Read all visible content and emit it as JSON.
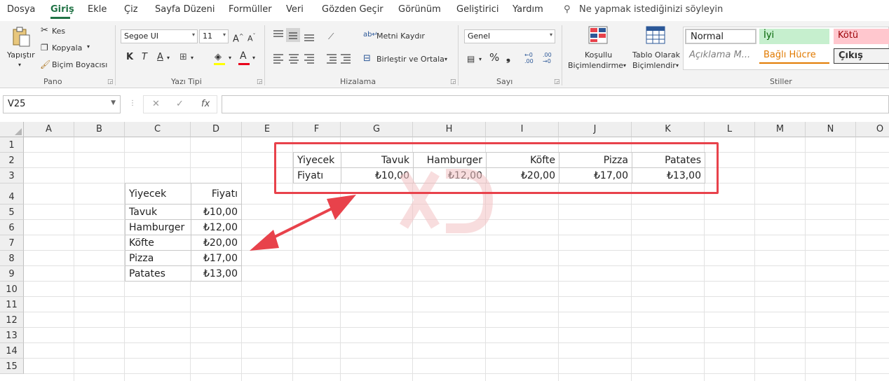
{
  "menu": {
    "items": [
      "Dosya",
      "Giriş",
      "Ekle",
      "Çiz",
      "Sayfa Düzeni",
      "Formüller",
      "Veri",
      "Gözden Geçir",
      "Görünüm",
      "Geliştirici",
      "Yardım"
    ],
    "active": "Giriş",
    "tell_me": "Ne yapmak istediğinizi söyleyin"
  },
  "ribbon": {
    "clipboard": {
      "paste": "Yapıştır",
      "cut": "Kes",
      "copy": "Kopyala",
      "format_painter": "Biçim Boyacısı",
      "label": "Pano"
    },
    "font": {
      "name": "Segoe UI",
      "size": "11",
      "bold": "K",
      "italic": "T",
      "underline": "A",
      "font_color": "A",
      "label": "Yazı Tipi"
    },
    "alignment": {
      "wrap_text": "Metni Kaydır",
      "merge_center": "Birleştir ve Ortala",
      "label": "Hizalama"
    },
    "number": {
      "format": "Genel",
      "label": "Sayı"
    },
    "styles": {
      "conditional_line1": "Koşullu",
      "conditional_line2": "Biçimlendirme",
      "table_line1": "Tablo Olarak",
      "table_line2": "Biçimlendir",
      "normal": "Normal",
      "good": "İyi",
      "bad": "Kötü",
      "explanatory": "Açıklama M...",
      "linked_cell": "Bağlı Hücre",
      "output": "Çıkış",
      "label": "Stiller"
    }
  },
  "formula_bar": {
    "name_box": "V25",
    "cancel": "✕",
    "enter": "✓",
    "fx": "fx",
    "value": ""
  },
  "grid": {
    "columns": [
      "A",
      "B",
      "C",
      "D",
      "E",
      "F",
      "G",
      "H",
      "I",
      "J",
      "K",
      "L",
      "M",
      "N",
      "O"
    ],
    "rows": [
      "1",
      "2",
      "3",
      "4",
      "5",
      "6",
      "7",
      "8",
      "9",
      "10",
      "11",
      "12",
      "13",
      "14",
      "15"
    ]
  },
  "vertical_table": {
    "headers": [
      "Yiyecek",
      "Fiyatı"
    ],
    "rows": [
      [
        "Tavuk",
        "₺10,00"
      ],
      [
        "Hamburger",
        "₺12,00"
      ],
      [
        "Köfte",
        "₺20,00"
      ],
      [
        "Pizza",
        "₺17,00"
      ],
      [
        "Patates",
        "₺13,00"
      ]
    ]
  },
  "horizontal_table": {
    "row1": [
      "Yiyecek",
      "Tavuk",
      "Hamburger",
      "Köfte",
      "Pizza",
      "Patates"
    ],
    "row2": [
      "Fiyatı",
      "₺10,00",
      "₺12,00",
      "₺20,00",
      "₺17,00",
      "₺13,00"
    ]
  },
  "colors": {
    "accent": "#217346",
    "annotation": "#e8424b",
    "good_bg": "#c6efce",
    "good_fg": "#006100",
    "bad_bg": "#ffc7ce",
    "bad_fg": "#9c0006",
    "linked_fg": "#e17a00"
  }
}
